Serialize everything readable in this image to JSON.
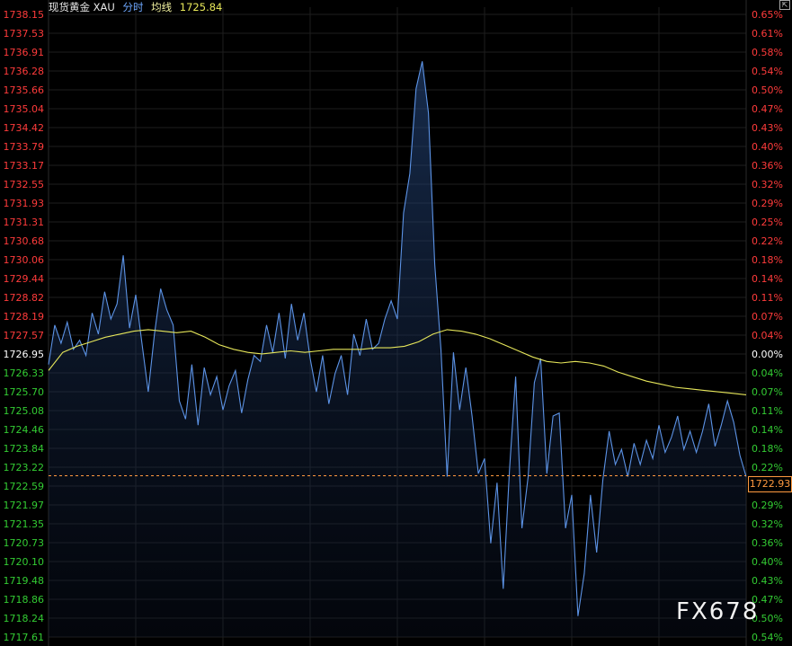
{
  "header": {
    "symbol": "现货黄金 XAU",
    "mode": "分时",
    "avg_label": "均线",
    "avg_value": "1725.84"
  },
  "current_price_tag": "1722.93",
  "watermark": "FX678",
  "colors": {
    "price_line": "#5c93e6",
    "avg_line": "#e6e65a",
    "up_axis": "#ff3b3b",
    "down_axis": "#33cc33",
    "neutral_axis": "#ffffff",
    "grid": "#1e1e1e",
    "ref_line": "#ff9a40"
  },
  "chart_data": {
    "type": "line",
    "series": [
      {
        "values": [
          1726.6,
          1727.9,
          1727.3,
          1728.0,
          1727.1,
          1727.4,
          1726.9,
          1728.3,
          1727.6,
          1729.0,
          1728.1,
          1728.6,
          1730.2,
          1727.8,
          1728.9,
          1727.3,
          1725.7,
          1727.6,
          1729.1,
          1728.4,
          1727.9,
          1725.4,
          1724.8,
          1726.6,
          1724.6,
          1726.5,
          1725.6,
          1726.2,
          1725.1,
          1725.9,
          1726.4,
          1725.0,
          1726.1,
          1726.9,
          1726.7,
          1727.9,
          1727.0,
          1728.3,
          1726.8,
          1728.6,
          1727.4,
          1728.3,
          1726.8,
          1725.7,
          1726.9,
          1725.3,
          1726.3,
          1726.9,
          1725.6,
          1727.6,
          1726.9,
          1728.1,
          1727.1,
          1727.3,
          1728.1,
          1728.7,
          1728.1,
          1731.6,
          1732.9,
          1735.7,
          1736.6,
          1734.9,
          1729.9,
          1727.1,
          1722.9,
          1727.0,
          1725.1,
          1726.5,
          1724.9,
          1723.0,
          1723.5,
          1720.7,
          1722.7,
          1719.2,
          1723.1,
          1726.2,
          1721.2,
          1722.9,
          1726.0,
          1726.8,
          1723.0,
          1724.9,
          1725.0,
          1721.2,
          1722.3,
          1718.3,
          1719.7,
          1722.3,
          1720.4,
          1722.8,
          1724.4,
          1723.3,
          1723.8,
          1722.9,
          1724.0,
          1723.3,
          1724.1,
          1723.5,
          1724.6,
          1723.7,
          1724.2,
          1724.9,
          1723.8,
          1724.4,
          1723.7,
          1724.4,
          1725.3,
          1723.9,
          1724.6,
          1725.4,
          1724.7,
          1723.6,
          1722.9
        ]
      },
      {
        "values": [
          1726.4,
          1727.0,
          1727.2,
          1727.35,
          1727.5,
          1727.6,
          1727.7,
          1727.75,
          1727.7,
          1727.65,
          1727.7,
          1727.5,
          1727.25,
          1727.1,
          1727.0,
          1726.95,
          1727.0,
          1727.05,
          1727.0,
          1727.05,
          1727.1,
          1727.1,
          1727.1,
          1727.15,
          1727.15,
          1727.2,
          1727.35,
          1727.6,
          1727.75,
          1727.7,
          1727.6,
          1727.45,
          1727.25,
          1727.05,
          1726.85,
          1726.7,
          1726.65,
          1726.7,
          1726.65,
          1726.55,
          1726.35,
          1726.2,
          1726.05,
          1725.95,
          1725.85,
          1725.8,
          1725.75,
          1725.7,
          1725.65,
          1725.6
        ]
      }
    ],
    "y_left_ticks": [
      "1738.15",
      "1737.53",
      "1736.91",
      "1736.28",
      "1735.66",
      "1735.04",
      "1734.42",
      "1733.79",
      "1733.17",
      "1732.55",
      "1731.93",
      "1731.31",
      "1730.68",
      "1730.06",
      "1729.44",
      "1728.82",
      "1728.19",
      "1727.57",
      "1726.95",
      "1726.33",
      "1725.70",
      "1725.08",
      "1724.46",
      "1723.84",
      "1723.22",
      "1722.59",
      "1721.97",
      "1721.35",
      "1720.73",
      "1720.10",
      "1719.48",
      "1718.86",
      "1718.24",
      "1717.61"
    ],
    "y_right_ticks": [
      "0.65%",
      "0.61%",
      "0.58%",
      "0.54%",
      "0.50%",
      "0.47%",
      "0.43%",
      "0.40%",
      "0.36%",
      "0.32%",
      "0.29%",
      "0.25%",
      "0.22%",
      "0.18%",
      "0.14%",
      "0.11%",
      "0.07%",
      "0.04%",
      "0.00%",
      "0.04%",
      "0.07%",
      "0.11%",
      "0.14%",
      "0.18%",
      "0.22%",
      "0.25%",
      "0.29%",
      "0.32%",
      "0.36%",
      "0.40%",
      "0.43%",
      "0.47%",
      "0.50%",
      "0.54%"
    ],
    "ylim": [
      1717.61,
      1738.15
    ],
    "base_price": 1726.95,
    "ref_price": 1722.93,
    "grid": true
  }
}
